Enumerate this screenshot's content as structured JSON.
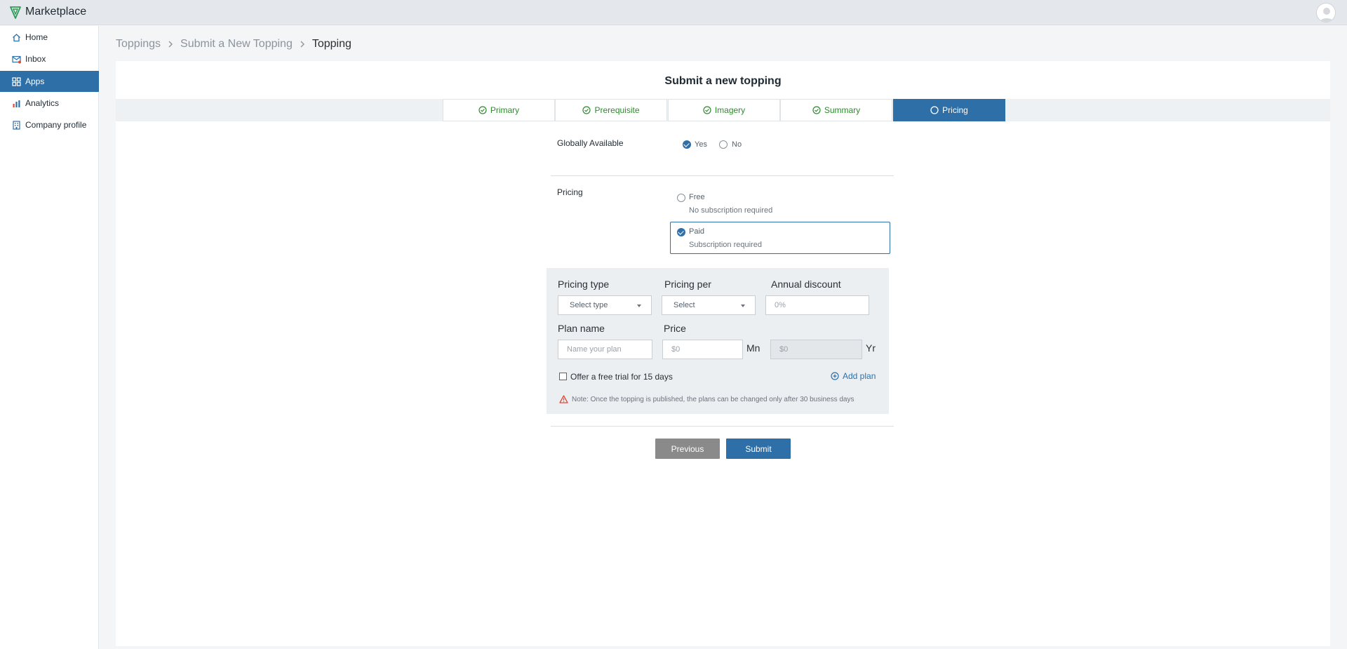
{
  "app": {
    "title": "Marketplace"
  },
  "sidebar": {
    "items": [
      {
        "label": "Home",
        "icon": "home-icon"
      },
      {
        "label": "Inbox",
        "icon": "inbox-icon"
      },
      {
        "label": "Apps",
        "icon": "apps-icon",
        "active": true
      },
      {
        "label": "Analytics",
        "icon": "analytics-icon"
      },
      {
        "label": "Company profile",
        "icon": "building-icon"
      }
    ]
  },
  "breadcrumb": [
    "Toppings",
    "Submit a New Topping",
    "Topping"
  ],
  "page": {
    "title": "Submit a new topping"
  },
  "tabs": [
    {
      "label": "Primary",
      "status": "complete"
    },
    {
      "label": "Prerequisite",
      "status": "complete"
    },
    {
      "label": "Imagery",
      "status": "complete"
    },
    {
      "label": "Summary",
      "status": "complete"
    },
    {
      "label": "Pricing",
      "status": "current"
    }
  ],
  "form": {
    "globally_available": {
      "label": "Globally Available",
      "options": [
        "Yes",
        "No"
      ],
      "selected": "Yes"
    },
    "pricing": {
      "label": "Pricing",
      "free": {
        "label": "Free",
        "desc": "No subscription required"
      },
      "paid": {
        "label": "Paid",
        "desc": "Subscription required"
      },
      "selected": "Paid"
    },
    "plan": {
      "pricing_type_label": "Pricing type",
      "pricing_type_value": "Select type",
      "pricing_per_label": "Pricing per",
      "pricing_per_value": "Select",
      "annual_discount_label": "Annual discount",
      "annual_discount_placeholder": "0%",
      "plan_name_label": "Plan name",
      "plan_name_placeholder": "Name your plan",
      "price_label": "Price",
      "price_month_placeholder": "$0",
      "price_month_unit": "Mn",
      "price_year_placeholder": "$0",
      "price_year_unit": "Yr",
      "free_trial_label": "Offer a free trial for 15 days",
      "add_plan_label": "Add plan",
      "note": "Note: Once the topping is published, the plans can be changed only after 30 business days"
    }
  },
  "actions": {
    "previous": "Previous",
    "submit": "Submit"
  },
  "colors": {
    "primary": "#2f6fa7",
    "success": "#2f8a2f",
    "warning": "#e0493a"
  }
}
